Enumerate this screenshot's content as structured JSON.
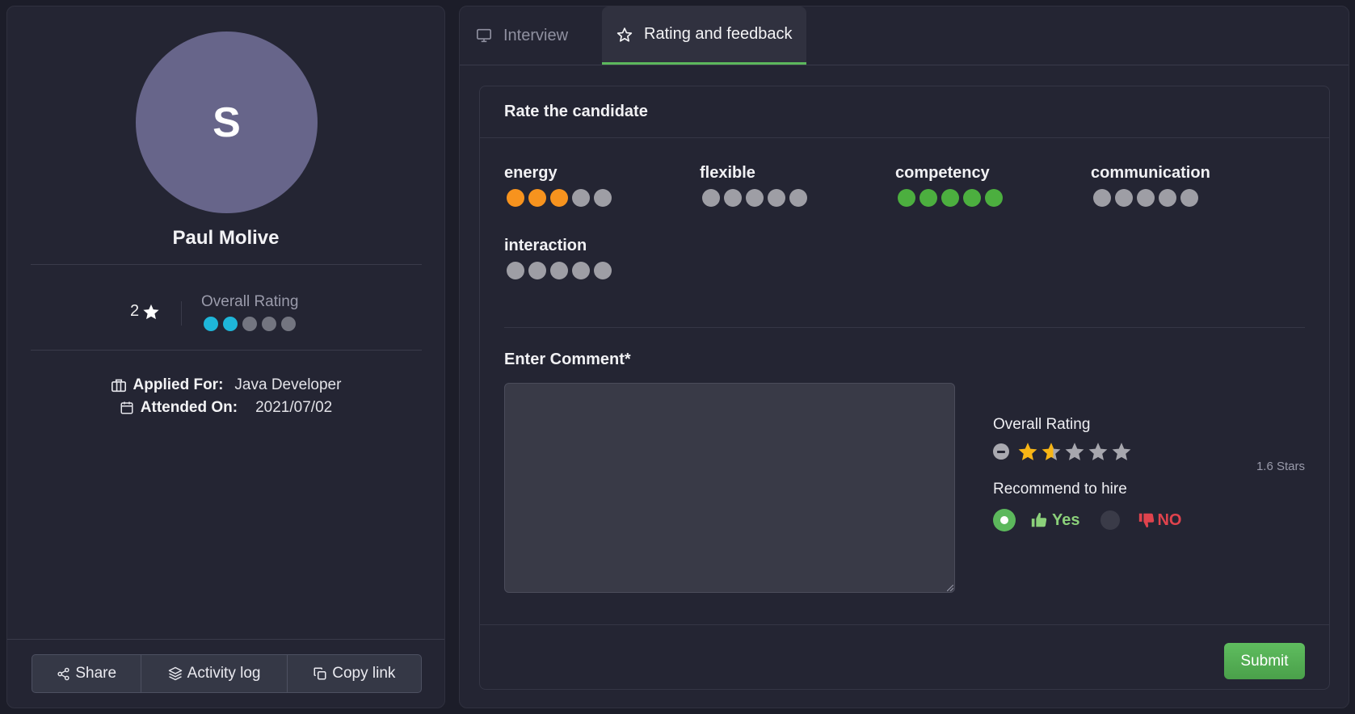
{
  "candidate": {
    "initial": "S",
    "name": "Paul Molive",
    "stars": "2",
    "overall_rating_label": "Overall Rating",
    "overall_rating_value": 2,
    "overall_rating_max": 5,
    "applied_for_label": "Applied For:",
    "applied_for": "Java Developer",
    "attended_on_label": "Attended On:",
    "attended_on": "2021/07/02"
  },
  "actions": {
    "share": "Share",
    "activity_log": "Activity log",
    "copy_link": "Copy link"
  },
  "tabs": {
    "interview": "Interview",
    "rating": "Rating and feedback"
  },
  "rating_form": {
    "title": "Rate the candidate",
    "criteria": [
      {
        "name": "energy",
        "value": 3,
        "color": "#f7931e"
      },
      {
        "name": "flexible",
        "value": 0,
        "color": "#9e9ea5"
      },
      {
        "name": "competency",
        "value": 5,
        "color": "#4caf3f"
      },
      {
        "name": "communication",
        "value": 0,
        "color": "#9e9ea5"
      },
      {
        "name": "interaction",
        "value": 0,
        "color": "#9e9ea5"
      }
    ],
    "comment_label": "Enter Comment*",
    "comment_value": "",
    "overall_label": "Overall Rating",
    "overall_stars": 1.6,
    "overall_stars_text": "1.6 Stars",
    "recommend_label": "Recommend to hire",
    "yes_label": "Yes",
    "no_label": "NO",
    "recommend_selected": "yes",
    "submit_label": "Submit"
  },
  "colors": {
    "accent_green": "#5cb85c",
    "overall_dot": "#1eb6d9",
    "star_gold": "#f7b515",
    "dot_empty": "#9e9ea5",
    "overall_dot_empty": "#737580"
  }
}
